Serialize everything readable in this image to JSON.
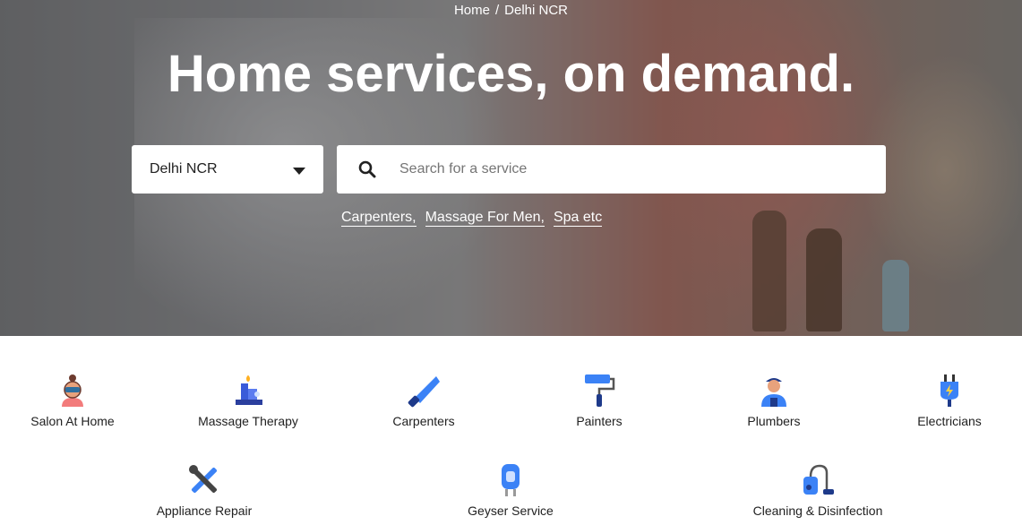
{
  "breadcrumb": {
    "home": "Home",
    "separator": "/",
    "current": "Delhi NCR"
  },
  "hero": {
    "title": "Home services, on demand."
  },
  "city_select": {
    "value": "Delhi NCR"
  },
  "search": {
    "placeholder": "Search for a service",
    "value": ""
  },
  "suggestions": [
    "Carpenters,",
    "Massage For Men,",
    "Spa etc"
  ],
  "categories": [
    {
      "label": "Salon At Home",
      "icon": "salon-icon"
    },
    {
      "label": "Massage Therapy",
      "icon": "candle-icon"
    },
    {
      "label": "Carpenters",
      "icon": "saw-icon"
    },
    {
      "label": "Painters",
      "icon": "paint-roller-icon"
    },
    {
      "label": "Plumbers",
      "icon": "plumber-icon"
    },
    {
      "label": "Electricians",
      "icon": "plug-icon"
    },
    {
      "label": "Appliance Repair",
      "icon": "tools-icon"
    },
    {
      "label": "Geyser Service",
      "icon": "geyser-icon"
    },
    {
      "label": "Cleaning & Disinfection",
      "icon": "vacuum-icon"
    }
  ],
  "colors": {
    "text": "#212121",
    "placeholder": "#757575",
    "white": "#ffffff"
  }
}
